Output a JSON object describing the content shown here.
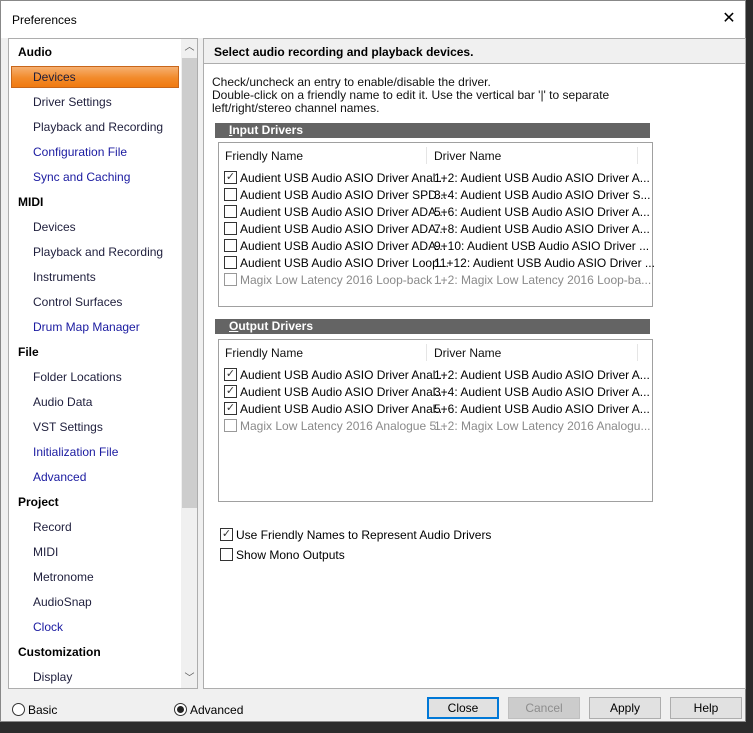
{
  "window": {
    "title": "Preferences"
  },
  "sidebar": {
    "sections": [
      {
        "label": "Audio",
        "items": [
          {
            "label": "Devices",
            "selected": true
          },
          {
            "label": "Driver Settings"
          },
          {
            "label": "Playback and Recording"
          },
          {
            "label": "Configuration File",
            "link": true
          },
          {
            "label": "Sync and Caching",
            "link": true
          }
        ]
      },
      {
        "label": "MIDI",
        "items": [
          {
            "label": "Devices"
          },
          {
            "label": "Playback and Recording"
          },
          {
            "label": "Instruments"
          },
          {
            "label": "Control Surfaces"
          },
          {
            "label": "Drum Map Manager",
            "link": true
          }
        ]
      },
      {
        "label": "File",
        "items": [
          {
            "label": "Folder Locations"
          },
          {
            "label": "Audio Data"
          },
          {
            "label": "VST Settings"
          },
          {
            "label": "Initialization File",
            "link": true
          },
          {
            "label": "Advanced",
            "link": true
          }
        ]
      },
      {
        "label": "Project",
        "items": [
          {
            "label": "Record"
          },
          {
            "label": "MIDI"
          },
          {
            "label": "Metronome"
          },
          {
            "label": "AudioSnap"
          },
          {
            "label": "Clock",
            "link": true
          }
        ]
      },
      {
        "label": "Customization",
        "items": [
          {
            "label": "Display"
          }
        ]
      }
    ]
  },
  "main": {
    "header": "Select audio recording and playback devices.",
    "desc1": "Check/uncheck an entry to enable/disable the driver.",
    "desc2": "Double-click on a friendly name to edit it. Use the vertical bar '|' to separate left/right/stereo channel names.",
    "columns": {
      "friendly": "Friendly Name",
      "driver": "Driver Name"
    },
    "input": {
      "title_key": "I",
      "title_rest": "nput Drivers",
      "rows": [
        {
          "friendly": "Audient USB Audio ASIO Driver Anal...",
          "driver": "1+2: Audient USB Audio ASIO Driver A...",
          "checked": true,
          "disabled": false
        },
        {
          "friendly": "Audient USB Audio ASIO Driver SPD...",
          "driver": "3+4: Audient USB Audio ASIO Driver S...",
          "checked": false,
          "disabled": false
        },
        {
          "friendly": "Audient USB Audio ASIO Driver ADA...",
          "driver": "5+6: Audient USB Audio ASIO Driver A...",
          "checked": false,
          "disabled": false
        },
        {
          "friendly": "Audient USB Audio ASIO Driver ADA...",
          "driver": "7+8: Audient USB Audio ASIO Driver A...",
          "checked": false,
          "disabled": false
        },
        {
          "friendly": "Audient USB Audio ASIO Driver ADA...",
          "driver": "9+10: Audient USB Audio ASIO Driver ...",
          "checked": false,
          "disabled": false
        },
        {
          "friendly": "Audient USB Audio ASIO Driver Loop...",
          "driver": "11+12: Audient USB Audio ASIO Driver ...",
          "checked": false,
          "disabled": false
        },
        {
          "friendly": "Magix Low Latency 2016 Loop-back ...",
          "driver": "1+2: Magix Low Latency 2016 Loop-ba...",
          "checked": false,
          "disabled": true
        }
      ]
    },
    "output": {
      "title_key": "O",
      "title_rest": "utput Drivers",
      "rows": [
        {
          "friendly": "Audient USB Audio ASIO Driver Anal...",
          "driver": "1+2: Audient USB Audio ASIO Driver A...",
          "checked": true,
          "disabled": false
        },
        {
          "friendly": "Audient USB Audio ASIO Driver Anal...",
          "driver": "3+4: Audient USB Audio ASIO Driver A...",
          "checked": true,
          "disabled": false
        },
        {
          "friendly": "Audient USB Audio ASIO Driver Anal...",
          "driver": "5+6: Audient USB Audio ASIO Driver A...",
          "checked": true,
          "disabled": false
        },
        {
          "friendly": "Magix Low Latency 2016 Analogue 5...",
          "driver": "1+2: Magix Low Latency 2016 Analogu...",
          "checked": false,
          "disabled": true
        }
      ]
    },
    "options": [
      {
        "label": "Use Friendly Names to Represent Audio Drivers",
        "checked": true
      },
      {
        "label": "Show Mono Outputs",
        "checked": false
      }
    ]
  },
  "footer": {
    "mode_basic": "Basic",
    "mode_advanced": "Advanced",
    "selected_mode": "Advanced",
    "close": "Close",
    "cancel": "Cancel",
    "apply": "Apply",
    "help": "Help"
  }
}
